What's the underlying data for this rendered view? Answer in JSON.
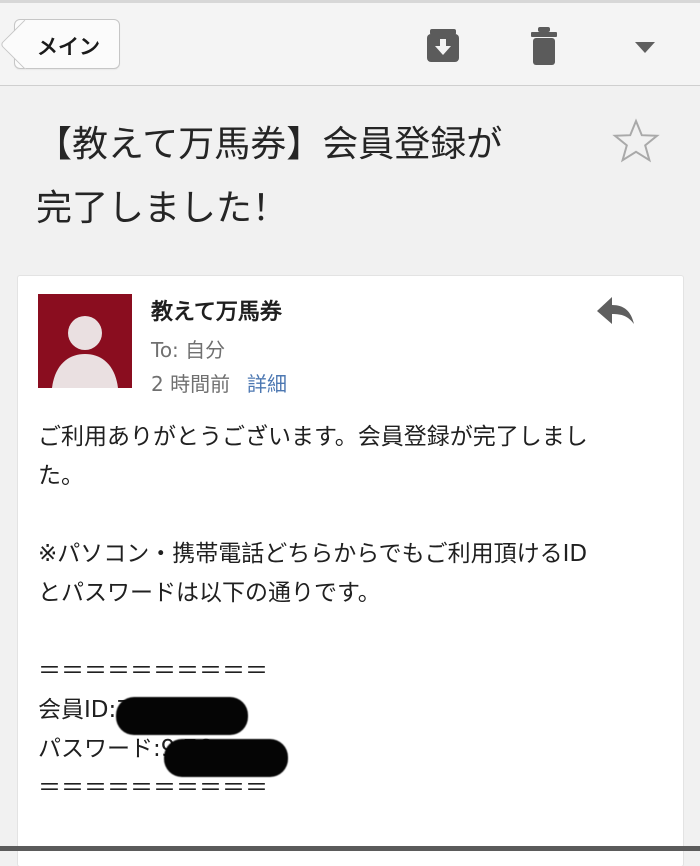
{
  "toolbar": {
    "back_label": "メイン",
    "archive_icon": "archive-icon",
    "delete_icon": "trash-icon",
    "more_icon": "chevron-down-icon"
  },
  "email": {
    "subject_line_1": "【教えて万馬券】会員登録が",
    "subject_line_2": "完了しました！",
    "sender": "教えて万馬券",
    "recipient": "To: 自分",
    "time": "2 時間前",
    "details_link": "詳細",
    "body_lines": [
      "ご利用ありがとうございます。会員登録が完了しまし",
      "た。",
      "",
      "※パソコン・携帯電話どちらからでもご利用頂けるID",
      "とパスワードは以下の通りです。",
      "",
      "＝＝＝＝＝＝＝＝＝＝",
      "会員ID:7    66",
      "パスワード:9    76",
      "＝＝＝＝＝＝＝＝＝＝"
    ]
  },
  "colors": {
    "avatar_background": "#8a0d1f",
    "link": "#4d78b2",
    "page_background": "#f1f1f1"
  }
}
